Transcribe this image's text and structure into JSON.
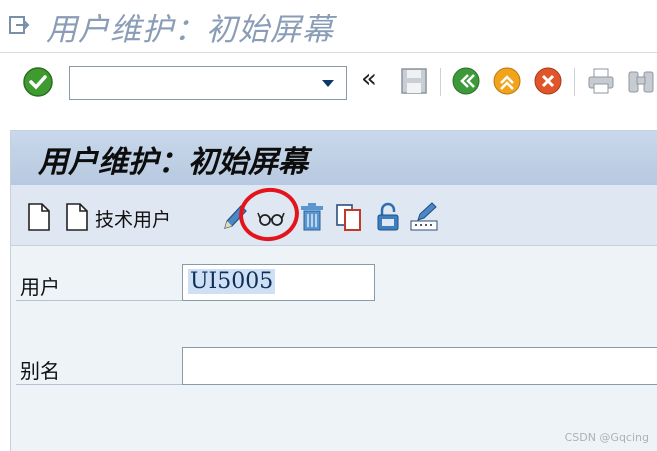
{
  "window": {
    "title": "用户维护：初始屏幕"
  },
  "toolbar": {
    "command_field_value": "",
    "icons": [
      "enter-check-icon",
      "save-icon",
      "back-icon",
      "exit-icon",
      "cancel-icon",
      "print-icon",
      "find-icon"
    ]
  },
  "panel": {
    "title": "用户维护：初始屏幕"
  },
  "app_toolbar": {
    "tech_user_label": "技术用户",
    "icons": [
      "create-icon",
      "create-tech-user-icon",
      "change-pencil-icon",
      "display-glasses-icon",
      "delete-trash-icon",
      "copy-icon",
      "lock-icon",
      "change-password-icon"
    ]
  },
  "form": {
    "user_label": "用户",
    "user_value": "UI5005",
    "alias_label": "别名",
    "alias_value": ""
  },
  "watermark": "CSDN @Gqcing",
  "colors": {
    "accent_red": "#e3141b",
    "panel_bg": "#eef3f8",
    "header_bg": "#c9d8ea"
  }
}
